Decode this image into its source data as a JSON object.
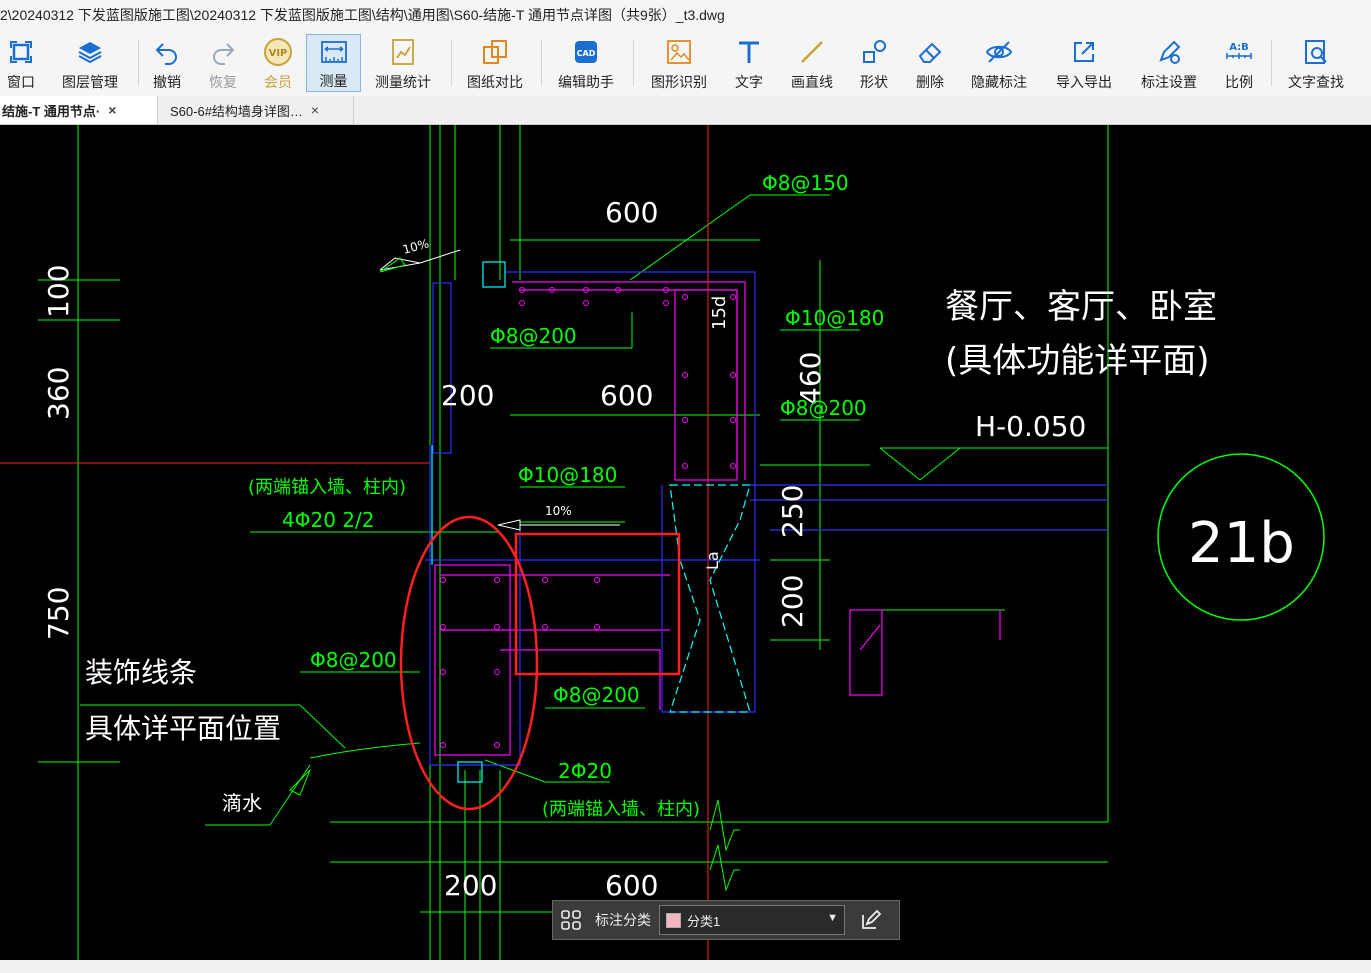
{
  "window": {
    "title": "2\\20240312 下发蓝图版施工图\\20240312 下发蓝图版施工图\\结构\\通用图\\S60-结施-T 通用节点详图（共9张）_t3.dwg"
  },
  "toolbar": {
    "window_label": "窗口",
    "layers_label": "图层管理",
    "undo_label": "撤销",
    "redo_label": "恢复",
    "vip_label": "会员",
    "measure_label": "测量",
    "measure_stats_label": "测量统计",
    "compare_label": "图纸对比",
    "edit_helper_label": "编辑助手",
    "shape_recog_label": "图形识别",
    "text_label": "文字",
    "line_label": "画直线",
    "shape_label": "形状",
    "delete_label": "删除",
    "hide_label": "隐藏标注",
    "import_export_label": "导入导出",
    "annot_settings_label": "标注设置",
    "scale_label": "比例",
    "text_search_label": "文字查找",
    "vip_icon_text": "VIP",
    "ab_icon_text": "A:B",
    "cad_icon_text": "CAD",
    "accent": "#1a6fd1"
  },
  "tabs": [
    {
      "label": "结施-T  通用节点·",
      "close": "×"
    },
    {
      "label": "S60-6#结构墙身详图…",
      "close": "×"
    }
  ],
  "drawing": {
    "dim_600_top": "600",
    "phi8_150": "Φ8@150",
    "pct_10_top": "10%",
    "phi8_200_a": "Φ8@200",
    "phi10_180_a": "Φ10@180",
    "dim_15d": "15d",
    "dim_460": "460",
    "dim_200_mid": "200",
    "dim_600_mid": "600",
    "phi8_200_b": "Φ8@200",
    "room_line1": "餐厅、客厅、卧室",
    "room_line2": "(具体功能详平面)",
    "elev": "H-0.050",
    "dim_100": "100",
    "dim_360": "360",
    "dim_750": "750",
    "anchor_note1": "(两端锚入墙、柱内)",
    "rebar_4phi20": "4Φ20 2/2",
    "phi10_180_b": "Φ10@180",
    "pct_10_mid": "10%",
    "la": "La",
    "dim_250": "250",
    "dim_200_right": "200",
    "detail_no": "21b",
    "phi8_200_c": "Φ8@200",
    "phi8_200_d": "Φ8@200",
    "deco_line1": "装饰线条",
    "deco_line2": "具体详平面位置",
    "drip": "滴水",
    "rebar_2phi20": "2Φ20",
    "anchor_note2": "(两端锚入墙、柱内)",
    "dim_200_bottom": "200",
    "dim_600_bottom": "600",
    "colors": {
      "green": "#00ff00",
      "magenta": "#ff00ff",
      "cyan": "#00ffff",
      "blue": "#3030ff",
      "white": "#ffffff",
      "red": "#ff2020"
    }
  },
  "annotation_bar": {
    "label": "标注分类",
    "selected": "分类1",
    "swatch_color": "#f4b4c0"
  }
}
